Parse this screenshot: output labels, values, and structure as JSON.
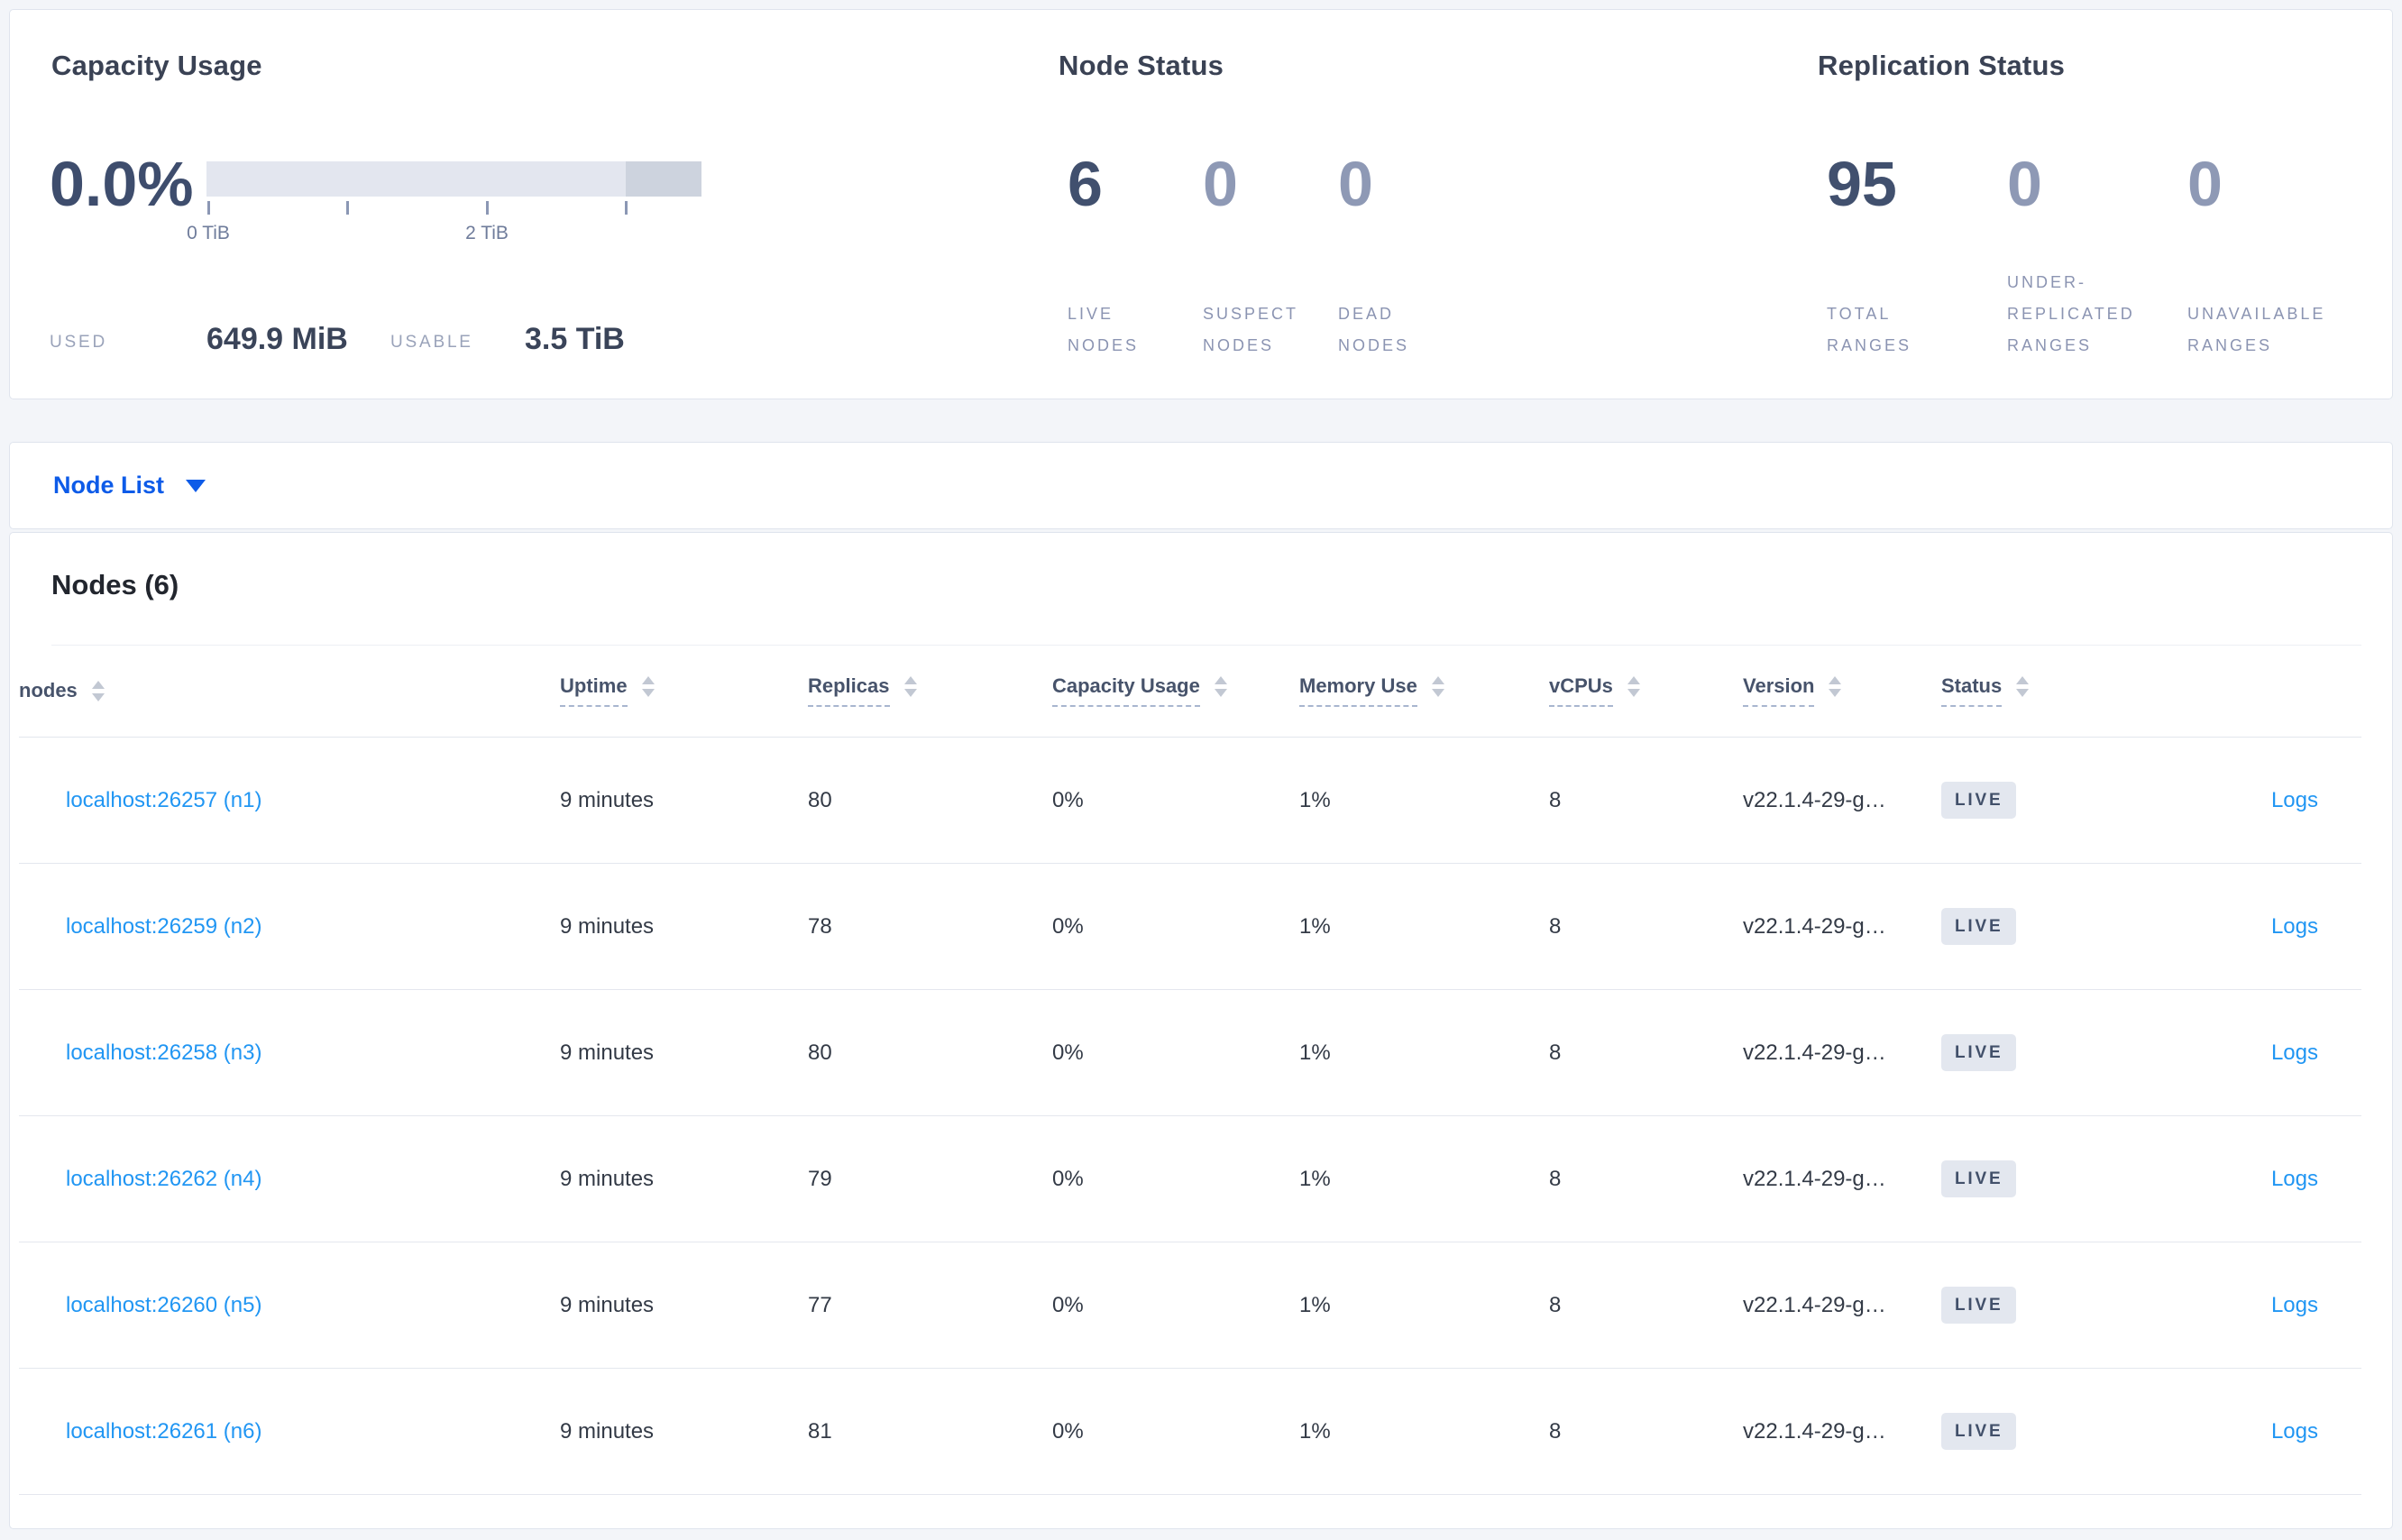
{
  "summary": {
    "capacity": {
      "title": "Capacity Usage",
      "percent_used": "0.0%",
      "used_label": "USED",
      "used_value": "649.9 MiB",
      "usable_label": "USABLE",
      "usable_value": "3.5 TiB",
      "axis_ticks": [
        {
          "label": "0 TiB"
        },
        {
          "label": ""
        },
        {
          "label": "2 TiB"
        },
        {
          "label": ""
        }
      ],
      "bar_colors": {
        "track": "#e3e6ef",
        "end_segment": "#cdd3de"
      }
    },
    "node_status": {
      "title": "Node Status",
      "stats": [
        {
          "value": "6",
          "label": "LIVE NODES",
          "muted": false
        },
        {
          "value": "0",
          "label": "SUSPECT NODES",
          "muted": true
        },
        {
          "value": "0",
          "label": "DEAD NODES",
          "muted": true
        }
      ]
    },
    "replication_status": {
      "title": "Replication Status",
      "stats": [
        {
          "value": "95",
          "label": "TOTAL RANGES",
          "muted": false
        },
        {
          "value": "0",
          "label": "UNDER-REPLICATED RANGES",
          "muted": true
        },
        {
          "value": "0",
          "label": "UNAVAILABLE RANGES",
          "muted": true
        }
      ]
    }
  },
  "view_selector": {
    "label": "Node List"
  },
  "nodes_table": {
    "title": "Nodes (6)",
    "columns": [
      {
        "label": "nodes",
        "dashed": false,
        "sortable": true
      },
      {
        "label": "Uptime",
        "dashed": true,
        "sortable": true
      },
      {
        "label": "Replicas",
        "dashed": true,
        "sortable": true
      },
      {
        "label": "Capacity Usage",
        "dashed": true,
        "sortable": true
      },
      {
        "label": "Memory Use",
        "dashed": true,
        "sortable": true
      },
      {
        "label": "vCPUs",
        "dashed": true,
        "sortable": true
      },
      {
        "label": "Version",
        "dashed": true,
        "sortable": true
      },
      {
        "label": "Status",
        "dashed": true,
        "sortable": true
      },
      {
        "label": "",
        "dashed": false,
        "sortable": false
      }
    ],
    "rows": [
      {
        "node": "localhost:26257 (n1)",
        "uptime": "9 minutes",
        "replicas": "80",
        "capacity_usage": "0%",
        "memory_use": "1%",
        "vcpus": "8",
        "version": "v22.1.4-29-g…",
        "status": "LIVE",
        "logs": "Logs"
      },
      {
        "node": "localhost:26259 (n2)",
        "uptime": "9 minutes",
        "replicas": "78",
        "capacity_usage": "0%",
        "memory_use": "1%",
        "vcpus": "8",
        "version": "v22.1.4-29-g…",
        "status": "LIVE",
        "logs": "Logs"
      },
      {
        "node": "localhost:26258 (n3)",
        "uptime": "9 minutes",
        "replicas": "80",
        "capacity_usage": "0%",
        "memory_use": "1%",
        "vcpus": "8",
        "version": "v22.1.4-29-g…",
        "status": "LIVE",
        "logs": "Logs"
      },
      {
        "node": "localhost:26262 (n4)",
        "uptime": "9 minutes",
        "replicas": "79",
        "capacity_usage": "0%",
        "memory_use": "1%",
        "vcpus": "8",
        "version": "v22.1.4-29-g…",
        "status": "LIVE",
        "logs": "Logs"
      },
      {
        "node": "localhost:26260 (n5)",
        "uptime": "9 minutes",
        "replicas": "77",
        "capacity_usage": "0%",
        "memory_use": "1%",
        "vcpus": "8",
        "version": "v22.1.4-29-g…",
        "status": "LIVE",
        "logs": "Logs"
      },
      {
        "node": "localhost:26261 (n6)",
        "uptime": "9 minutes",
        "replicas": "81",
        "capacity_usage": "0%",
        "memory_use": "1%",
        "vcpus": "8",
        "version": "v22.1.4-29-g…",
        "status": "LIVE",
        "logs": "Logs"
      }
    ]
  },
  "colors": {
    "accent_blue": "#0d5be8",
    "link_blue": "#2196f3",
    "stat_primary": "#41506e",
    "stat_muted": "#8e99b5",
    "badge_bg": "#e3e7ef",
    "badge_text": "#42506a"
  }
}
